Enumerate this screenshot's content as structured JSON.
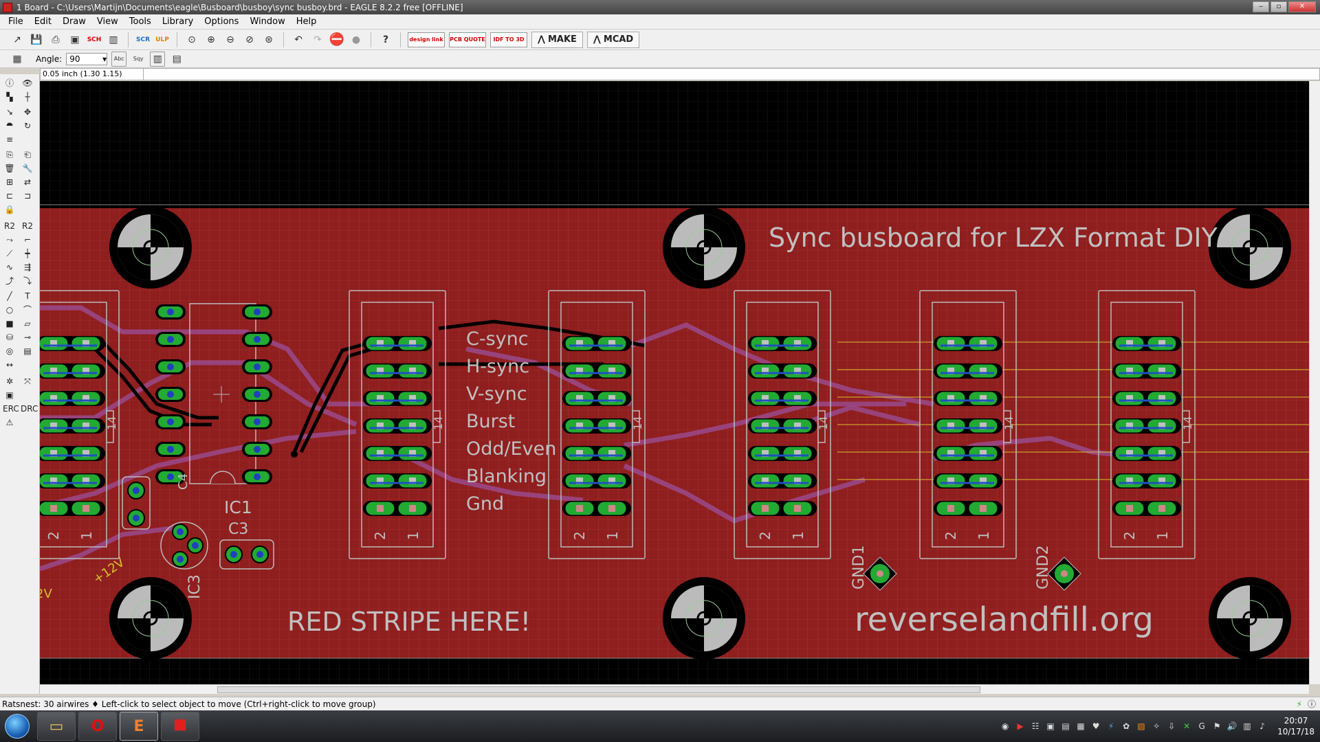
{
  "window": {
    "title": "1 Board - C:\\Users\\Martijn\\Documents\\eagle\\Busboard\\busboy\\sync busboy.brd - EAGLE 8.2.2 free [OFFLINE]"
  },
  "menu": [
    "File",
    "Edit",
    "Draw",
    "View",
    "Tools",
    "Library",
    "Options",
    "Window",
    "Help"
  ],
  "toolbar": {
    "buttons": [
      "open-icon",
      "save-icon",
      "print-icon",
      "cam-icon",
      "sch-icon",
      "library-icon",
      "script-icon",
      "ulp-icon",
      "zoom-fit-icon",
      "zoom-in-icon",
      "zoom-out-icon",
      "zoom-redraw-icon",
      "zoom-select-icon",
      "undo-icon",
      "redo-icon",
      "stop-icon",
      "go-icon",
      "help-icon"
    ],
    "design_link": "design link",
    "pcb_quote": "PCB QUOTE",
    "idf": "IDF TO 3D",
    "make": "MAKE",
    "mcad": "MCAD"
  },
  "params": {
    "angle_label": "Angle:",
    "angle_value": "90",
    "text_abc": "Abc",
    "text_sqy": "Sqy"
  },
  "command": {
    "coord": "0.05 inch (1.30 1.15)",
    "value": ""
  },
  "board": {
    "title_text": "Sync busboard for LZX Format DIY",
    "signal_labels": [
      "C-sync",
      "H-sync",
      "V-sync",
      "Burst",
      "Odd/Even",
      "Blanking",
      "Gnd"
    ],
    "red_stripe": "RED STRIPE HERE!",
    "url": "reverselandfill.org",
    "parts": {
      "ic1": "IC1",
      "ic3": "IC3",
      "c3": "C3",
      "c4": "C4",
      "gnd1": "GND1",
      "gnd2": "GND2",
      "v12": "+12V",
      "v12b": "2V"
    },
    "pin2": "2",
    "pin1": "1",
    "pin14": "14"
  },
  "status": {
    "text": "Ratsnest: 30 airwires  ♦ Left-click to select object to move (Ctrl+right-click to move group)"
  },
  "taskbar": {
    "time": "20:07",
    "date": "10/17/18"
  }
}
